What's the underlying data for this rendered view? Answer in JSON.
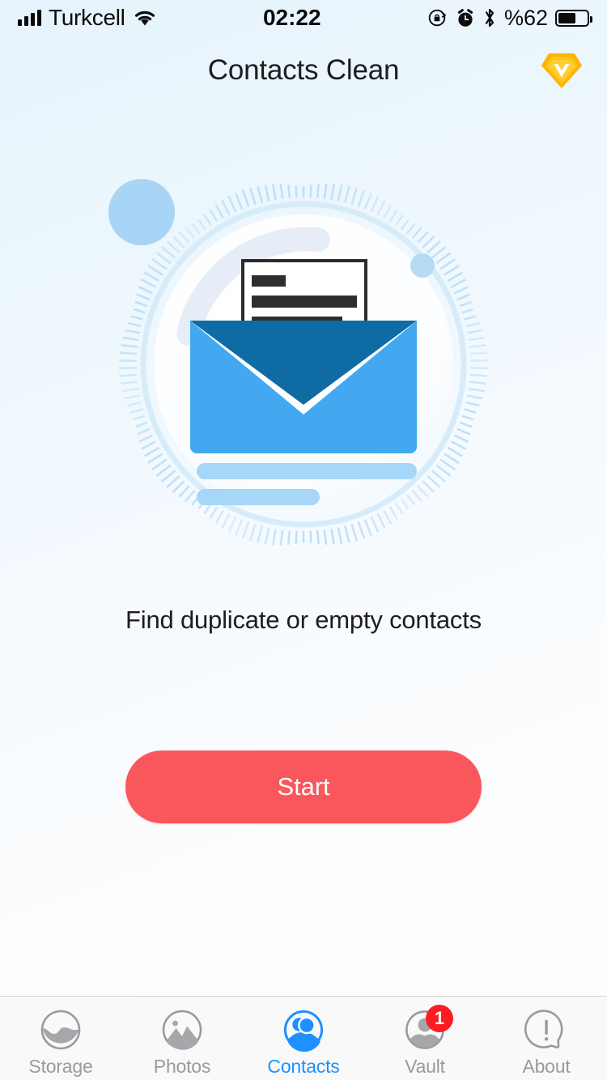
{
  "status_bar": {
    "carrier": "Turkcell",
    "time": "02:22",
    "battery_percent": "%62",
    "battery_level": 62,
    "icons": [
      "signal-bars-icon",
      "wifi-icon",
      "rotation-lock-icon",
      "alarm-clock-icon",
      "bluetooth-icon",
      "battery-icon"
    ]
  },
  "header": {
    "title": "Contacts Clean",
    "premium_icon": "diamond-premium-icon"
  },
  "hero": {
    "illustration_name": "open-envelope-contacts-illustration",
    "envelope_front_color": "#42a9f0",
    "envelope_back_color": "#0f6ba3",
    "letter_color": "#ffffff",
    "letter_border_color": "#2b2b2b",
    "ring_color": "#bfe0f7",
    "accent_dot_color": "#a8d4f5"
  },
  "main": {
    "tagline": "Find duplicate or empty contacts",
    "start_label": "Start",
    "start_color": "#f9575c"
  },
  "tabbar": {
    "active_color": "#1e90ff",
    "inactive_color": "#9a9a9e",
    "items": [
      {
        "label": "Storage",
        "icon": "storage-gauge-icon",
        "active": false,
        "badge": ""
      },
      {
        "label": "Photos",
        "icon": "photos-mountain-icon",
        "active": false,
        "badge": ""
      },
      {
        "label": "Contacts",
        "icon": "contacts-people-icon",
        "active": true,
        "badge": ""
      },
      {
        "label": "Vault",
        "icon": "vault-person-icon",
        "active": false,
        "badge": "1"
      },
      {
        "label": "About",
        "icon": "about-info-bubble-icon",
        "active": false,
        "badge": ""
      }
    ]
  }
}
